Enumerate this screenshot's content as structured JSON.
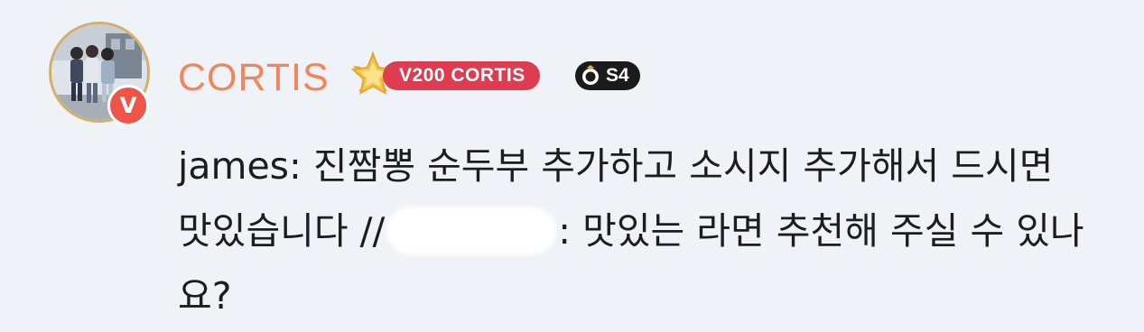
{
  "user": {
    "name": "CORTIS",
    "avatar_badge": "V",
    "level_badge": "V200 CORTIS",
    "season_badge": "S4"
  },
  "message": {
    "part1": "james: 진짬뽕 순두부 추가하고 소시지 추가해서 드시면 맛있습니다 //",
    "part2": ": 맛있는 라면 추천해 주실 수 있나요?"
  },
  "colors": {
    "username": "#f2865a",
    "level_badge_bg": "#de3c50",
    "season_badge_bg": "#1b1b1b",
    "avatar_ring": "#d3b06a",
    "v_badge": "#ee5548"
  },
  "icons": {
    "star": "star-medal-icon",
    "season": "ring-icon"
  }
}
